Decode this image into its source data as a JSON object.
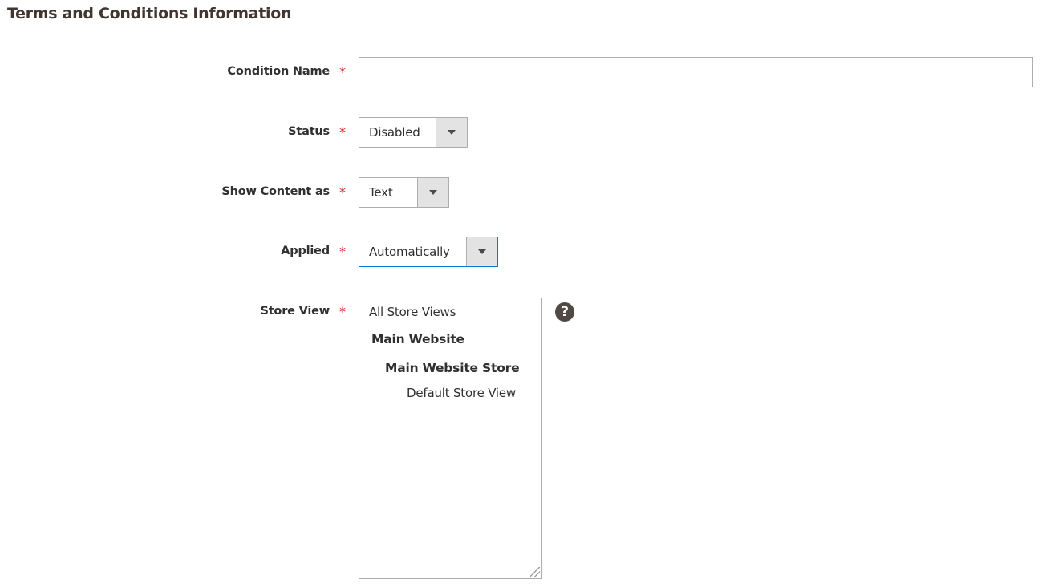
{
  "title": "Terms and Conditions Information",
  "required_mark": "*",
  "fields": {
    "condition_name": {
      "label": "Condition Name",
      "value": ""
    },
    "status": {
      "label": "Status",
      "value": "Disabled"
    },
    "show_content_as": {
      "label": "Show Content as",
      "value": "Text"
    },
    "applied": {
      "label": "Applied",
      "value": "Automatically"
    },
    "store_view": {
      "label": "Store View",
      "options": [
        "All Store Views",
        "Main Website",
        "Main Website Store",
        "Default Store View"
      ]
    }
  },
  "help_icon": "?",
  "colors": {
    "required": "#e22626",
    "focus_border": "#007bdb",
    "help_icon": "#514943"
  }
}
